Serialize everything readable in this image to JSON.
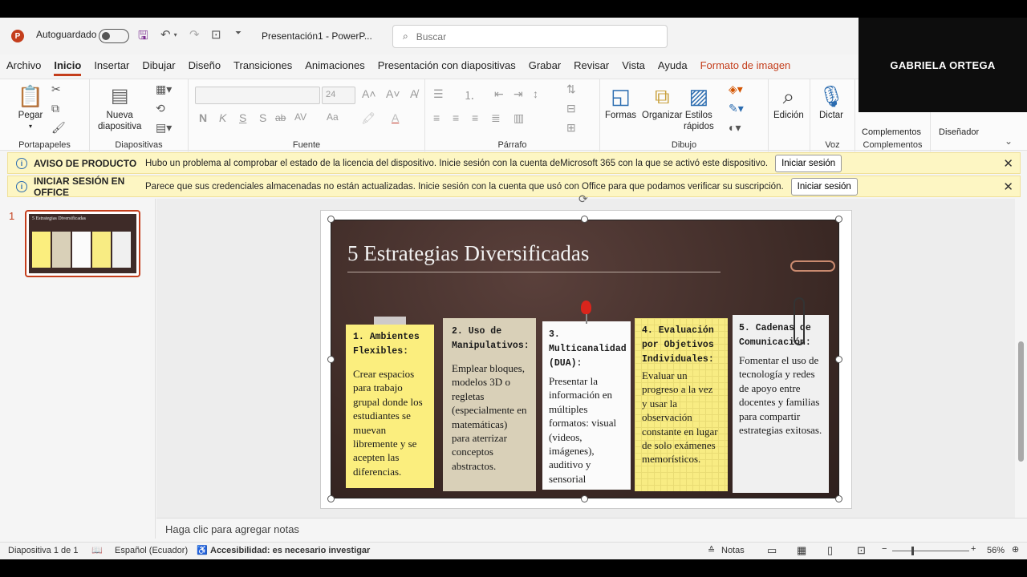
{
  "titlebar": {
    "autosave_label": "Autoguardado",
    "doc_title": "Presentación1 - PowerP...",
    "search_placeholder": "Buscar"
  },
  "camera": {
    "name": "GABRIELA ORTEGA"
  },
  "menu": [
    "Archivo",
    "Inicio",
    "Insertar",
    "Dibujar",
    "Diseño",
    "Transiciones",
    "Animaciones",
    "Presentación con diapositivas",
    "Grabar",
    "Revisar",
    "Vista",
    "Ayuda",
    "Formato de imagen"
  ],
  "ribbon": {
    "paste": "Pegar",
    "new_slide_1": "Nueva",
    "new_slide_2": "diapositiva",
    "font_size": "24",
    "shapes": "Formas",
    "arrange": "Organizar",
    "styles_1": "Estilos",
    "styles_2": "rápidos",
    "edit": "Edición",
    "dictate": "Dictar",
    "addins": "Complementos",
    "designer": "Diseñador",
    "groups": {
      "clipboard": "Portapapeles",
      "slides": "Diapositivas",
      "font": "Fuente",
      "paragraph": "Párrafo",
      "drawing": "Dibujo",
      "voice": "Voz",
      "addins": "Complementos"
    },
    "font_buttons": [
      "N",
      "K",
      "S",
      "S",
      "ab",
      "AV",
      "Aa"
    ]
  },
  "notices": [
    {
      "title": "AVISO DE PRODUCTO",
      "message": "Hubo un problema al comprobar el estado de la licencia del dispositivo. Inicie sesión con la cuenta deMicrosoft 365 con la que se activó este dispositivo.",
      "button": "Iniciar sesión"
    },
    {
      "title": "INICIAR SESIÓN EN OFFICE",
      "message": "Parece que sus credenciales almacenadas no están actualizadas. Inicie sesión con la cuenta que usó con Office para que podamos verificar su suscripción.",
      "button": "Iniciar sesión"
    }
  ],
  "thumbnail": {
    "number": "1",
    "title": "5 Estrategias Diversificadas"
  },
  "slide": {
    "title": "5 Estrategias Diversificadas",
    "notes": [
      {
        "heading": "1. Ambientes Flexibles:",
        "body": "Crear espacios para trabajo grupal donde los estudiantes se muevan libremente y se acepten las diferencias."
      },
      {
        "heading": "2. Uso de Manipulativos:",
        "body": "Emplear bloques, modelos 3D o regletas (especialmente en matemáticas) para aterrizar conceptos abstractos."
      },
      {
        "heading": "3. Multicanalidad (DUA):",
        "body": "Presentar la información en múltiples formatos: visual (videos, imágenes), auditivo y sensorial"
      },
      {
        "heading": "4. Evaluación por Objetivos Individuales:",
        "body": "Evaluar un progreso a la vez y usar la observación constante en lugar de solo exámenes memorísticos."
      },
      {
        "heading": "5. Cadenas de Comunicación:",
        "body": "Fomentar el uso de tecnología y redes de apoyo entre docentes y familias para compartir estrategias exitosas."
      }
    ]
  },
  "notes_placeholder": "Haga clic para agregar notas",
  "status": {
    "slide_count": "Diapositiva 1 de 1",
    "language": "Español (Ecuador)",
    "accessibility": "Accesibilidad: es necesario investigar",
    "notes": "Notas",
    "zoom": "56%"
  }
}
